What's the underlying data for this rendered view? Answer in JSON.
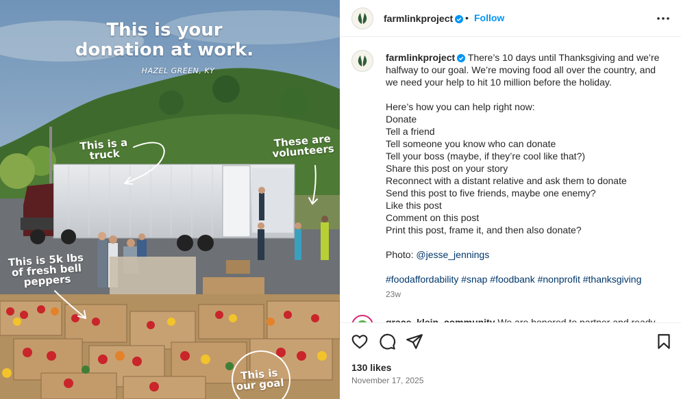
{
  "media": {
    "headline_line1": "This is your",
    "headline_line2": "donation at work.",
    "location": "HAZEL GREEN, KY",
    "annotations": {
      "truck": "This is a truck",
      "volunteers": "These are volunteers",
      "peppers": "This is 5k lbs of fresh bell peppers",
      "goal": "This is our goal"
    }
  },
  "post": {
    "author": "farmlinkproject",
    "follow_label": "Follow",
    "separator": "•",
    "caption_intro": "There’s 10 days until Thanksgiving and we’re halfway to our goal. We’re moving food all over the country, and we need your help to hit 10 million before the holiday.",
    "caption_list_title": "Here’s how you can help right now:",
    "caption_items": [
      "Donate",
      "Tell a friend",
      "Tell someone you know who can donate",
      "Tell your boss (maybe, if they’re cool like that?)",
      "Share this post on your story",
      "Reconnect with a distant relative and ask them to donate",
      "Send this post to five friends, maybe one enemy?",
      "Like this post",
      "Comment on this post",
      "Print this post, frame it, and then also donate?"
    ],
    "photo_label": "Photo:",
    "photo_credit": "@jesse_jennings",
    "hashtags": "#foodaffordability #snap #foodbank #nonprofit #thanksgiving",
    "age": "23w",
    "next_comment_user": "grace_klein_community",
    "next_comment_text": "We are honored to partner and ready",
    "likes": "130 likes",
    "date": "November 17, 2025"
  },
  "icons": {
    "more": "more-horizontal-icon",
    "like": "heart-icon",
    "comment": "comment-icon",
    "share": "send-icon",
    "save": "bookmark-icon",
    "verified": "verified-badge-icon"
  },
  "colors": {
    "link_blue": "#0095f6",
    "verified_blue": "#0095f6",
    "hashtag": "#00376b",
    "brand_green": "#2f5d3a"
  }
}
